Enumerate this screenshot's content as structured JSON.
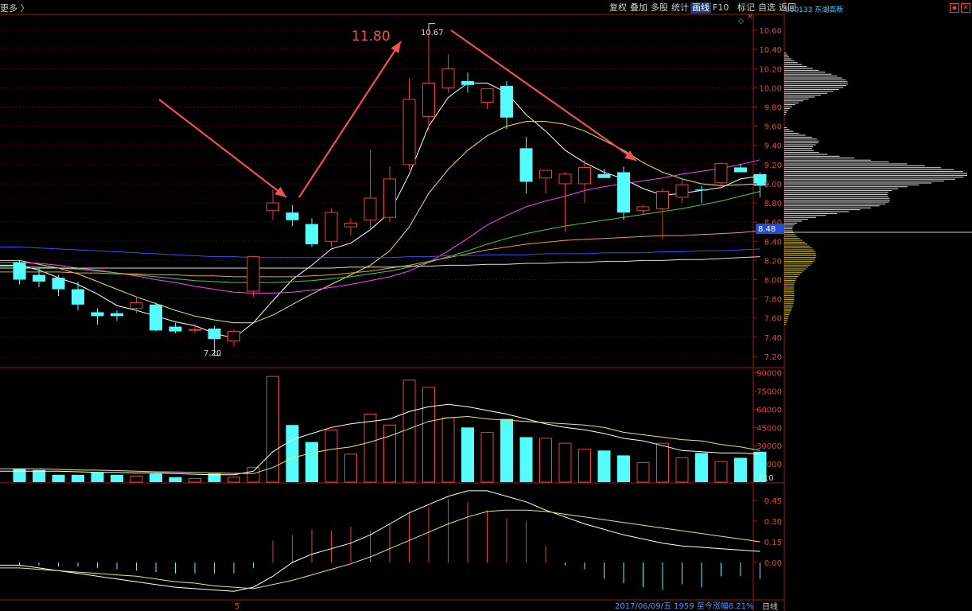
{
  "header": {
    "left_label": "更多 〉",
    "toolbar": [
      "复权",
      "叠加",
      "多股",
      "统计",
      "画线",
      "F10",
      "标记",
      "自选",
      "返回"
    ],
    "active_tool": "画线",
    "stock_code": "600133",
    "stock_name": "东湖高新"
  },
  "annotations": {
    "peak_price_label": "10.67",
    "low_price_label": "7.20",
    "target_label": "11.80",
    "current_price_tag": "8.48",
    "x_marker": "5",
    "status_text": "2017/06/09/五 1959 至今涨幅8.21%",
    "period_label": "日线",
    "volume_unit": "X10"
  },
  "colors": {
    "up": "#e84141",
    "down": "#54fcfc",
    "ma_white": "#ffffff",
    "ma_yellow": "#e8e864",
    "ma_magenta": "#ff40ff",
    "ma_green": "#40d040",
    "ma_orange": "#e8a040",
    "ma_blue": "#3050ff",
    "frame": "#a01818",
    "arrow": "#f05050"
  },
  "chart_data": [
    {
      "type": "candlestick",
      "title": "",
      "y_ticks": [
        "10.60",
        "10.40",
        "10.20",
        "10.00",
        "9.80",
        "9.60",
        "9.40",
        "9.20",
        "9.00",
        "8.80",
        "8.60",
        "8.40",
        "8.20",
        "8.00",
        "7.80",
        "7.60",
        "7.40",
        "7.20"
      ],
      "ylim": [
        7.1,
        10.75
      ],
      "ohlc": [
        [
          8.18,
          8.2,
          7.95,
          8.0
        ],
        [
          8.05,
          8.12,
          7.92,
          7.98
        ],
        [
          8.02,
          8.05,
          7.83,
          7.9
        ],
        [
          7.9,
          7.98,
          7.68,
          7.74
        ],
        [
          7.66,
          7.7,
          7.53,
          7.62
        ],
        [
          7.65,
          7.68,
          7.57,
          7.62
        ],
        [
          7.7,
          7.82,
          7.65,
          7.76
        ],
        [
          7.74,
          7.76,
          7.46,
          7.47
        ],
        [
          7.51,
          7.55,
          7.44,
          7.46
        ],
        [
          7.48,
          7.54,
          7.44,
          7.48
        ],
        [
          7.49,
          7.52,
          7.26,
          7.38
        ],
        [
          7.36,
          7.48,
          7.3,
          7.46
        ],
        [
          7.88,
          8.25,
          7.82,
          8.24
        ],
        [
          8.72,
          8.94,
          8.62,
          8.8
        ],
        [
          8.7,
          8.78,
          8.56,
          8.62
        ],
        [
          8.58,
          8.64,
          8.34,
          8.37
        ],
        [
          8.4,
          8.74,
          8.34,
          8.7
        ],
        [
          8.55,
          8.64,
          8.46,
          8.59
        ],
        [
          8.62,
          9.35,
          8.52,
          8.85
        ],
        [
          8.65,
          9.18,
          8.6,
          9.05
        ],
        [
          9.2,
          10.1,
          9.15,
          9.88
        ],
        [
          9.7,
          10.67,
          9.55,
          10.05
        ],
        [
          10.0,
          10.35,
          9.95,
          10.2
        ],
        [
          10.07,
          10.16,
          9.95,
          10.03
        ],
        [
          9.85,
          9.96,
          9.78,
          9.99
        ],
        [
          10.02,
          10.07,
          9.57,
          9.69
        ],
        [
          9.37,
          9.49,
          8.9,
          9.02
        ],
        [
          9.06,
          9.12,
          8.9,
          9.14
        ],
        [
          9.0,
          9.12,
          8.5,
          9.1
        ],
        [
          9.0,
          9.25,
          8.8,
          9.17
        ],
        [
          9.1,
          9.15,
          9.06,
          9.06
        ],
        [
          9.12,
          9.18,
          8.62,
          8.7
        ],
        [
          8.72,
          8.78,
          8.68,
          8.76
        ],
        [
          8.74,
          8.95,
          8.42,
          8.92
        ],
        [
          8.86,
          9.05,
          8.8,
          8.99
        ],
        [
          8.94,
          8.98,
          8.8,
          8.93
        ],
        [
          9.01,
          9.22,
          8.95,
          9.21
        ],
        [
          9.17,
          9.21,
          9.12,
          9.12
        ],
        [
          9.1,
          9.12,
          8.86,
          8.98
        ]
      ],
      "series": [
        {
          "name": "",
          "color": "#ffffff",
          "values": [
            8.15,
            8.1,
            8.02,
            7.95,
            7.85,
            7.73,
            7.68,
            7.62,
            7.56,
            7.52,
            7.44,
            7.39,
            7.55,
            7.78,
            8.0,
            8.15,
            8.32,
            8.38,
            8.52,
            8.7,
            9.1,
            9.6,
            9.9,
            10.05,
            10.05,
            9.95,
            9.72,
            9.55,
            9.35,
            9.22,
            9.12,
            9.05,
            8.95,
            8.88,
            8.9,
            8.93,
            8.96,
            9.05,
            9.08
          ]
        },
        {
          "name": "",
          "color": "#e8e864",
          "values": [
            8.2,
            8.16,
            8.12,
            8.06,
            7.98,
            7.9,
            7.82,
            7.75,
            7.68,
            7.62,
            7.58,
            7.55,
            7.55,
            7.63,
            7.74,
            7.85,
            7.95,
            8.05,
            8.15,
            8.3,
            8.55,
            8.9,
            9.15,
            9.35,
            9.5,
            9.6,
            9.65,
            9.65,
            9.62,
            9.55,
            9.45,
            9.35,
            9.22,
            9.12,
            9.05,
            9.0,
            8.98,
            8.99,
            9.0
          ]
        },
        {
          "name": "",
          "color": "#ff40ff",
          "values": [
            8.18,
            8.17,
            8.15,
            8.12,
            8.1,
            8.07,
            8.04,
            8.0,
            7.97,
            7.93,
            7.9,
            7.87,
            7.86,
            7.86,
            7.87,
            7.89,
            7.92,
            7.95,
            7.99,
            8.03,
            8.09,
            8.18,
            8.3,
            8.43,
            8.57,
            8.67,
            8.76,
            8.82,
            8.87,
            8.93,
            8.97,
            9.0,
            9.03,
            9.06,
            9.1,
            9.13,
            9.16,
            9.2,
            9.25
          ]
        },
        {
          "name": "",
          "color": "#40d040",
          "values": [
            8.14,
            8.13,
            8.12,
            8.11,
            8.09,
            8.07,
            8.05,
            8.03,
            8.01,
            7.99,
            7.98,
            7.97,
            7.97,
            7.97,
            7.98,
            7.99,
            8.01,
            8.03,
            8.06,
            8.09,
            8.13,
            8.18,
            8.24,
            8.3,
            8.37,
            8.43,
            8.48,
            8.52,
            8.56,
            8.59,
            8.62,
            8.65,
            8.68,
            8.71,
            8.74,
            8.78,
            8.82,
            8.87,
            8.92
          ]
        },
        {
          "name": "",
          "color": "#e8a040",
          "values": [
            8.08,
            8.08,
            8.08,
            8.07,
            8.07,
            8.06,
            8.06,
            8.05,
            8.05,
            8.04,
            8.04,
            8.03,
            8.03,
            8.03,
            8.03,
            8.04,
            8.05,
            8.07,
            8.09,
            8.12,
            8.15,
            8.19,
            8.23,
            8.27,
            8.31,
            8.34,
            8.37,
            8.39,
            8.41,
            8.42,
            8.43,
            8.44,
            8.45,
            8.46,
            8.46,
            8.47,
            8.48,
            8.49,
            8.51
          ]
        },
        {
          "name": "",
          "color": "#3050ff",
          "values": [
            8.34,
            8.33,
            8.32,
            8.31,
            8.3,
            8.29,
            8.28,
            8.27,
            8.26,
            8.25,
            8.24,
            8.24,
            8.23,
            8.23,
            8.23,
            8.23,
            8.23,
            8.23,
            8.23,
            8.23,
            8.24,
            8.24,
            8.25,
            8.25,
            8.26,
            8.26,
            8.26,
            8.27,
            8.27,
            8.27,
            8.28,
            8.28,
            8.28,
            8.29,
            8.29,
            8.3,
            8.3,
            8.31,
            8.32
          ]
        },
        {
          "name": "",
          "color": "#dddddd",
          "values": [
            8.12,
            8.12,
            8.12,
            8.12,
            8.12,
            8.12,
            8.12,
            8.12,
            8.12,
            8.12,
            8.12,
            8.12,
            8.12,
            8.12,
            8.12,
            8.12,
            8.12,
            8.13,
            8.13,
            8.13,
            8.14,
            8.14,
            8.15,
            8.15,
            8.16,
            8.16,
            8.17,
            8.17,
            8.18,
            8.18,
            8.19,
            8.19,
            8.2,
            8.2,
            8.21,
            8.21,
            8.22,
            8.23,
            8.24
          ]
        }
      ]
    },
    {
      "type": "bar",
      "title": "",
      "y_ticks": [
        "90000",
        "75000",
        "60000",
        "45000",
        "30000",
        "15000"
      ],
      "ylim": [
        0,
        93000
      ],
      "values": [
        11000,
        10000,
        6000,
        6000,
        8000,
        6000,
        5000,
        7000,
        4000,
        3000,
        7000,
        4000,
        12000,
        87000,
        47000,
        33000,
        43000,
        23000,
        56000,
        47000,
        84000,
        78000,
        53000,
        45000,
        41000,
        52000,
        37000,
        36000,
        32000,
        27000,
        26000,
        22000,
        16000,
        32000,
        20000,
        24000,
        17000,
        20000,
        25000
      ],
      "ma_series": [
        {
          "name": "",
          "color": "#ffffff",
          "values": [
            9000,
            9000,
            9000,
            8500,
            8000,
            8000,
            7500,
            7500,
            7000,
            6500,
            6000,
            6000,
            9000,
            25000,
            35000,
            40000,
            45000,
            48000,
            50000,
            52000,
            58000,
            62000,
            64000,
            62000,
            59000,
            56000,
            52000,
            48000,
            45000,
            43000,
            40000,
            36000,
            34000,
            30000,
            26000,
            25000,
            24000,
            24000,
            23000
          ]
        },
        {
          "name": "",
          "color": "#e8e864",
          "values": [
            11000,
            11000,
            10500,
            10000,
            9800,
            9500,
            9000,
            8500,
            8300,
            8000,
            7600,
            7200,
            7000,
            12000,
            20000,
            24000,
            27000,
            29000,
            33000,
            38000,
            44000,
            50000,
            53000,
            54000,
            52000,
            51000,
            50000,
            49000,
            48000,
            47000,
            45000,
            41000,
            39000,
            37000,
            35000,
            34000,
            31000,
            29000,
            26000
          ]
        }
      ]
    },
    {
      "type": "bar",
      "title": "",
      "y_ticks": [
        "0.45",
        "0.30",
        "0.15",
        "0.00"
      ],
      "ylim": [
        -0.26,
        0.56
      ],
      "values": [
        -0.02,
        -0.02,
        -0.03,
        -0.03,
        -0.04,
        -0.05,
        -0.06,
        -0.07,
        -0.08,
        -0.08,
        -0.08,
        -0.08,
        -0.04,
        0.16,
        0.2,
        0.24,
        0.23,
        0.26,
        0.23,
        0.28,
        0.36,
        0.4,
        0.46,
        0.44,
        0.38,
        0.32,
        0.3,
        0.12,
        -0.02,
        -0.05,
        -0.12,
        -0.15,
        -0.18,
        -0.2,
        -0.16,
        -0.18,
        -0.1,
        -0.1,
        -0.12
      ],
      "ma_series": [
        {
          "name": "",
          "color": "#ffffff",
          "values": [
            -0.02,
            -0.04,
            -0.06,
            -0.08,
            -0.1,
            -0.12,
            -0.14,
            -0.16,
            -0.18,
            -0.19,
            -0.2,
            -0.21,
            -0.18,
            -0.1,
            0.0,
            0.06,
            0.1,
            0.14,
            0.2,
            0.28,
            0.36,
            0.42,
            0.48,
            0.52,
            0.52,
            0.48,
            0.44,
            0.38,
            0.33,
            0.28,
            0.24,
            0.2,
            0.17,
            0.14,
            0.12,
            0.11,
            0.1,
            0.09,
            0.08
          ]
        },
        {
          "name": "",
          "color": "#e8e864",
          "values": [
            -0.04,
            -0.05,
            -0.06,
            -0.07,
            -0.08,
            -0.09,
            -0.1,
            -0.12,
            -0.14,
            -0.15,
            -0.17,
            -0.18,
            -0.19,
            -0.16,
            -0.13,
            -0.09,
            -0.05,
            -0.01,
            0.04,
            0.1,
            0.16,
            0.22,
            0.28,
            0.33,
            0.37,
            0.38,
            0.38,
            0.37,
            0.35,
            0.33,
            0.31,
            0.29,
            0.27,
            0.25,
            0.23,
            0.21,
            0.19,
            0.17,
            0.15
          ]
        }
      ]
    }
  ]
}
